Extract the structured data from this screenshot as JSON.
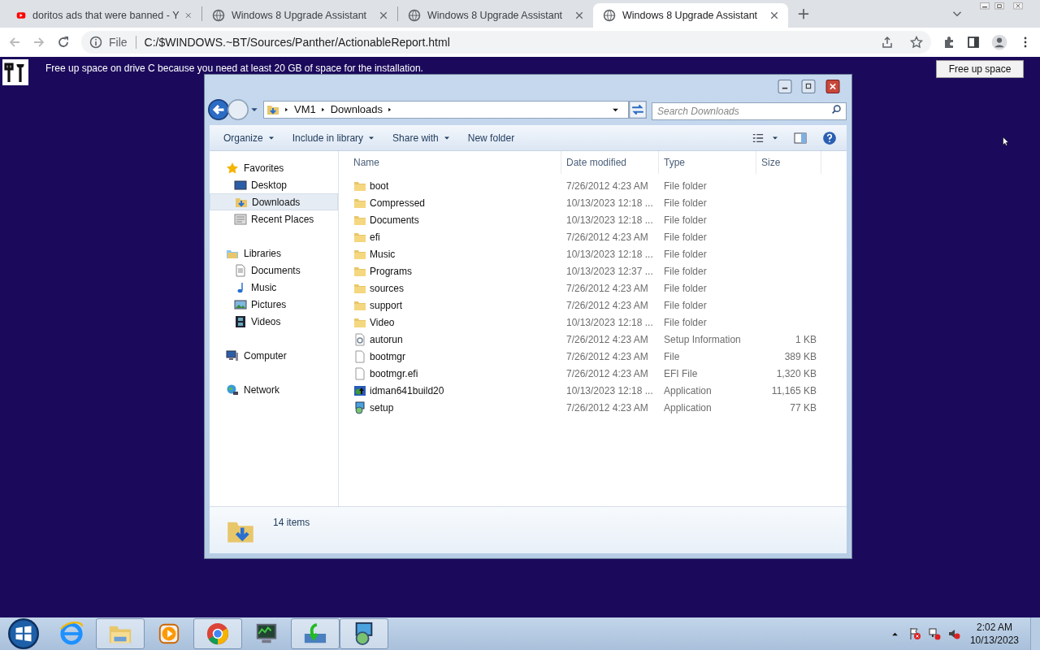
{
  "browser": {
    "tabs": [
      {
        "title": "doritos ads that were banned - Y",
        "kind": "video",
        "selected": false
      },
      {
        "title": "Windows 8 Upgrade Assistant",
        "kind": "globe",
        "selected": false
      },
      {
        "title": "Windows 8 Upgrade Assistant",
        "kind": "globe",
        "selected": false
      },
      {
        "title": "Windows 8 Upgrade Assistant",
        "kind": "globe",
        "selected": true
      }
    ],
    "address": {
      "scheme": "File",
      "url": "C:/$WINDOWS.~BT/Sources/Panther/ActionableReport.html"
    }
  },
  "banner": {
    "message": "Free up space on drive C because you need at least 20 GB of space for the installation.",
    "button": "Free up space"
  },
  "explorer": {
    "breadcrumb": [
      "VM1",
      "Downloads"
    ],
    "search": {
      "placeholder": "Search Downloads"
    },
    "toolbar": [
      {
        "label": "Organize",
        "dropdown": true
      },
      {
        "label": "Include in library",
        "dropdown": true
      },
      {
        "label": "Share with",
        "dropdown": true
      },
      {
        "label": "New folder",
        "dropdown": false
      }
    ],
    "nav": [
      {
        "label": "Favorites",
        "kind": "star",
        "children": [
          {
            "label": "Desktop",
            "kind": "desktop",
            "selected": false
          },
          {
            "label": "Downloads",
            "kind": "downloads",
            "selected": true
          },
          {
            "label": "Recent Places",
            "kind": "recent",
            "selected": false
          }
        ]
      },
      {
        "label": "Libraries",
        "kind": "library",
        "children": [
          {
            "label": "Documents",
            "kind": "document",
            "selected": false
          },
          {
            "label": "Music",
            "kind": "music",
            "selected": false
          },
          {
            "label": "Pictures",
            "kind": "pictures",
            "selected": false
          },
          {
            "label": "Videos",
            "kind": "videos",
            "selected": false
          }
        ]
      },
      {
        "label": "Computer",
        "kind": "computer"
      },
      {
        "label": "Network",
        "kind": "network"
      }
    ],
    "columns": [
      "Name",
      "Date modified",
      "Type",
      "Size"
    ],
    "rows": [
      {
        "name": "boot",
        "kind": "folder",
        "date": "7/26/2012 4:23 AM",
        "type": "File folder"
      },
      {
        "name": "Compressed",
        "kind": "folder",
        "date": "10/13/2023 12:18 ...",
        "type": "File folder"
      },
      {
        "name": "Documents",
        "kind": "folder",
        "date": "10/13/2023 12:18 ...",
        "type": "File folder"
      },
      {
        "name": "efi",
        "kind": "folder",
        "date": "7/26/2012 4:23 AM",
        "type": "File folder"
      },
      {
        "name": "Music",
        "kind": "folder",
        "date": "10/13/2023 12:18 ...",
        "type": "File folder"
      },
      {
        "name": "Programs",
        "kind": "folder",
        "date": "10/13/2023 12:37 ...",
        "type": "File folder"
      },
      {
        "name": "sources",
        "kind": "folder",
        "date": "7/26/2012 4:23 AM",
        "type": "File folder"
      },
      {
        "name": "support",
        "kind": "folder",
        "date": "7/26/2012 4:23 AM",
        "type": "File folder"
      },
      {
        "name": "Video",
        "kind": "folder",
        "date": "10/13/2023 12:18 ...",
        "type": "File folder"
      },
      {
        "name": "autorun",
        "kind": "settings-file",
        "date": "7/26/2012 4:23 AM",
        "type": "Setup Information",
        "size": "1 KB"
      },
      {
        "name": "bootmgr",
        "kind": "file",
        "date": "7/26/2012 4:23 AM",
        "type": "File",
        "size": "389 KB"
      },
      {
        "name": "bootmgr.efi",
        "kind": "file",
        "date": "7/26/2012 4:23 AM",
        "type": "EFI File",
        "size": "1,320 KB"
      },
      {
        "name": "idman641build20",
        "kind": "app",
        "date": "10/13/2023 12:18 ...",
        "type": "Application",
        "size": "11,165 KB"
      },
      {
        "name": "setup",
        "kind": "setup",
        "date": "7/26/2012 4:23 AM",
        "type": "Application",
        "size": "77 KB"
      }
    ],
    "status": "14 items"
  },
  "taskbar": {
    "apps": [
      {
        "kind": "ie",
        "running": false
      },
      {
        "kind": "explorer",
        "running": true
      },
      {
        "kind": "media",
        "running": false
      },
      {
        "kind": "chrome",
        "running": true
      },
      {
        "kind": "monitor",
        "running": false
      },
      {
        "kind": "install",
        "running": true
      },
      {
        "kind": "setup",
        "running": true
      }
    ],
    "time": "2:02 AM",
    "date": "10/13/2023"
  }
}
